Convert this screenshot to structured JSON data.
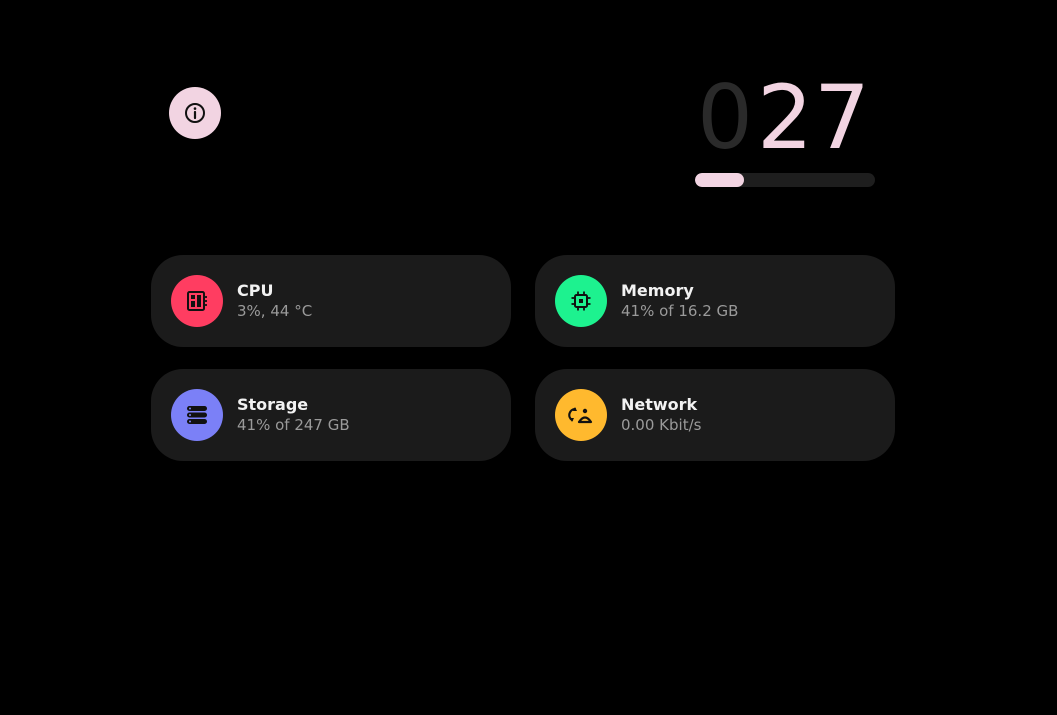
{
  "counter": {
    "digits": [
      "0",
      "2",
      "7"
    ],
    "active_color": "#f2d4e2",
    "inactive_color": "#2a2a2a",
    "progress": 0.27
  },
  "info_button": {
    "icon": "info-icon",
    "color": "#f2d4e2"
  },
  "stats": {
    "cpu": {
      "title": "CPU",
      "value": "3%, 44 °C",
      "icon": "cpu-icon",
      "color": "#ff3d61"
    },
    "memory": {
      "title": "Memory",
      "value": "41% of 16.2 GB",
      "icon": "chip-icon",
      "color": "#1df28f"
    },
    "storage": {
      "title": "Storage",
      "value": "41% of 247 GB",
      "icon": "storage-icon",
      "color": "#7b80f7"
    },
    "network": {
      "title": "Network",
      "value": "0.00 Kbit/s",
      "icon": "network-icon",
      "color": "#ffb92e"
    }
  }
}
